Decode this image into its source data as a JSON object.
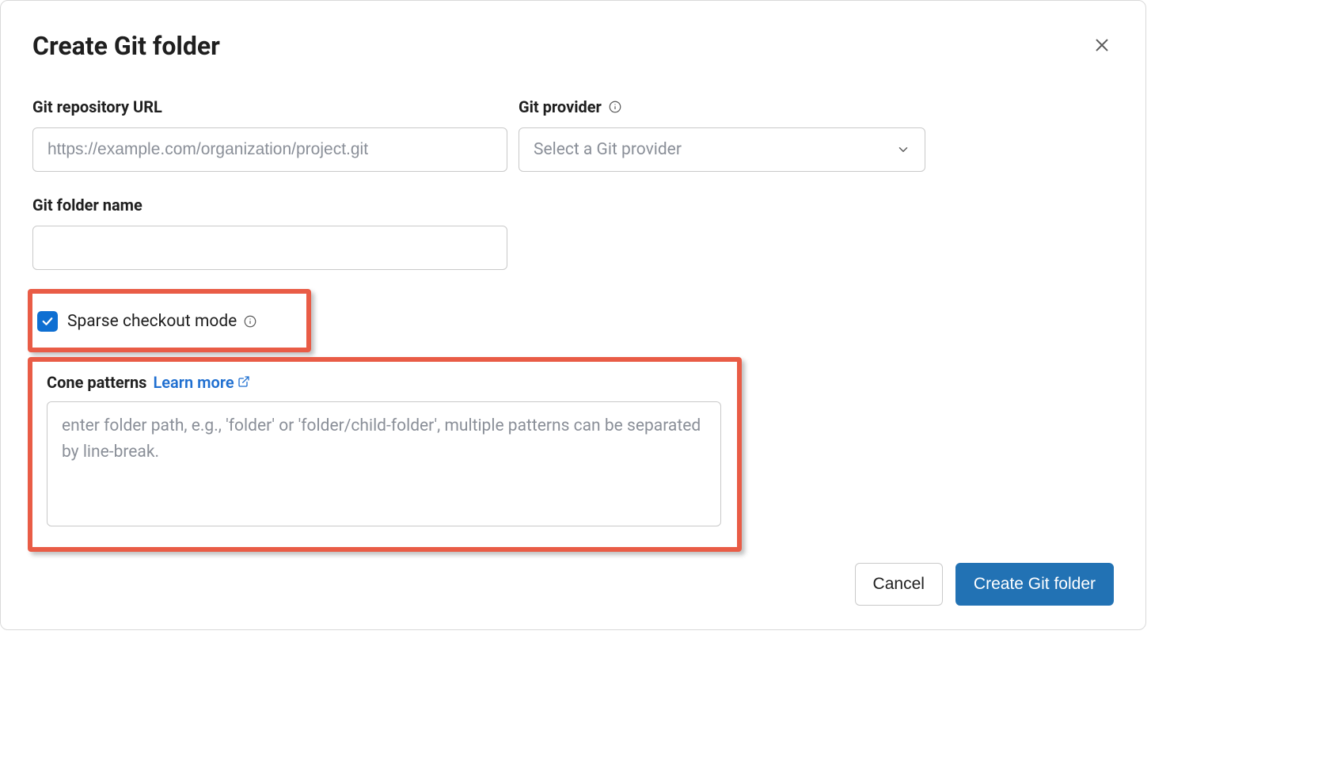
{
  "dialog": {
    "title": "Create Git folder"
  },
  "fields": {
    "repo_url": {
      "label": "Git repository URL",
      "placeholder": "https://example.com/organization/project.git",
      "value": ""
    },
    "provider": {
      "label": "Git provider",
      "placeholder": "Select a Git provider",
      "selected": ""
    },
    "folder_name": {
      "label": "Git folder name",
      "value": ""
    },
    "sparse": {
      "label": "Sparse checkout mode",
      "checked": true
    },
    "cone": {
      "label": "Cone patterns",
      "learn_more": "Learn more",
      "placeholder": "enter folder path, e.g., 'folder' or 'folder/child-folder', multiple patterns can be separated by line-break.",
      "value": ""
    }
  },
  "buttons": {
    "cancel": "Cancel",
    "submit": "Create Git folder"
  },
  "colors": {
    "highlight": "#e95c46",
    "primary": "#2272b4",
    "link": "#1f6fd0",
    "checkbox": "#0e6fd2"
  }
}
